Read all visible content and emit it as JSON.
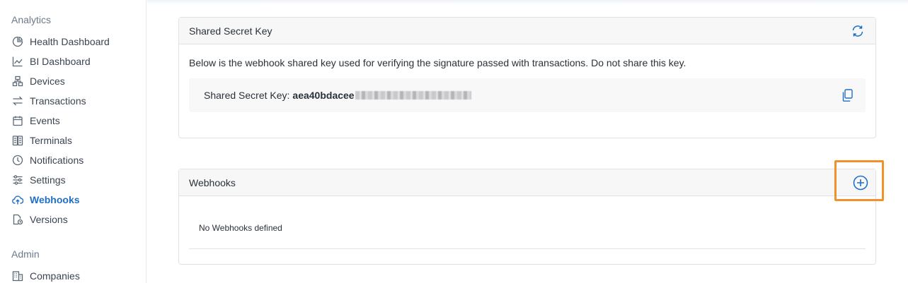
{
  "sidebar": {
    "sections": [
      {
        "title": "Analytics"
      },
      {
        "title": "Admin"
      }
    ],
    "items": [
      {
        "label": "Health Dashboard",
        "icon": "pie-chart-icon"
      },
      {
        "label": "BI Dashboard",
        "icon": "line-chart-icon"
      },
      {
        "label": "Devices",
        "icon": "devices-icon"
      },
      {
        "label": "Transactions",
        "icon": "arrows-exchange-icon"
      },
      {
        "label": "Events",
        "icon": "calendar-icon"
      },
      {
        "label": "Terminals",
        "icon": "terminal-icon"
      },
      {
        "label": "Notifications",
        "icon": "clock-icon"
      },
      {
        "label": "Settings",
        "icon": "sliders-icon"
      },
      {
        "label": "Webhooks",
        "icon": "cloud-upload-icon",
        "active": true
      },
      {
        "label": "Versions",
        "icon": "file-clock-icon"
      },
      {
        "label": "Companies",
        "icon": "building-icon"
      }
    ]
  },
  "secret_card": {
    "title": "Shared Secret Key",
    "refresh_icon": "refresh-icon",
    "description": "Below is the webhook shared key used for verifying the signature passed with transactions. Do not share this key.",
    "key_label": "Shared Secret Key:",
    "key_value": "aea40bdacee",
    "copy_icon": "copy-icon"
  },
  "webhooks_card": {
    "title": "Webhooks",
    "add_icon": "plus-circle-icon",
    "empty_text": "No Webhooks defined"
  },
  "colors": {
    "accent": "#1f6fc5",
    "highlight": "#f0922a",
    "muted": "#6c7a89"
  }
}
